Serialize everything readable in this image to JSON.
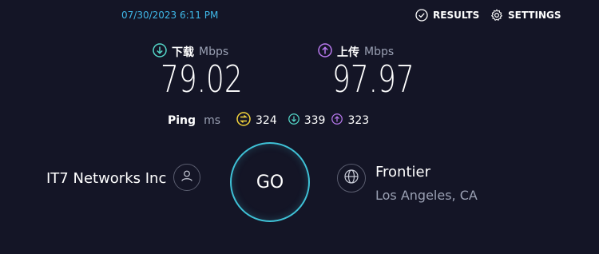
{
  "header": {
    "timestamp": "07/30/2023 6:11 PM",
    "results_label": "RESULTS",
    "settings_label": "SETTINGS"
  },
  "download": {
    "label": "下载",
    "unit": "Mbps",
    "value": "79.02",
    "icon": "download-arrow-icon",
    "color": "#54d6c8"
  },
  "upload": {
    "label": "上传",
    "unit": "Mbps",
    "value": "97.97",
    "icon": "upload-arrow-icon",
    "color": "#b879ee"
  },
  "ping": {
    "label": "Ping",
    "unit": "ms",
    "idle": "324",
    "download": "339",
    "upload": "323",
    "idle_color": "#f5d53b"
  },
  "isp": {
    "name": "IT7 Networks Inc",
    "icon": "user-icon"
  },
  "go_button": {
    "label": "GO",
    "ring_color": "#3fc1d6"
  },
  "server": {
    "name": "Frontier",
    "location": "Los Angeles, CA",
    "icon": "globe-icon"
  }
}
